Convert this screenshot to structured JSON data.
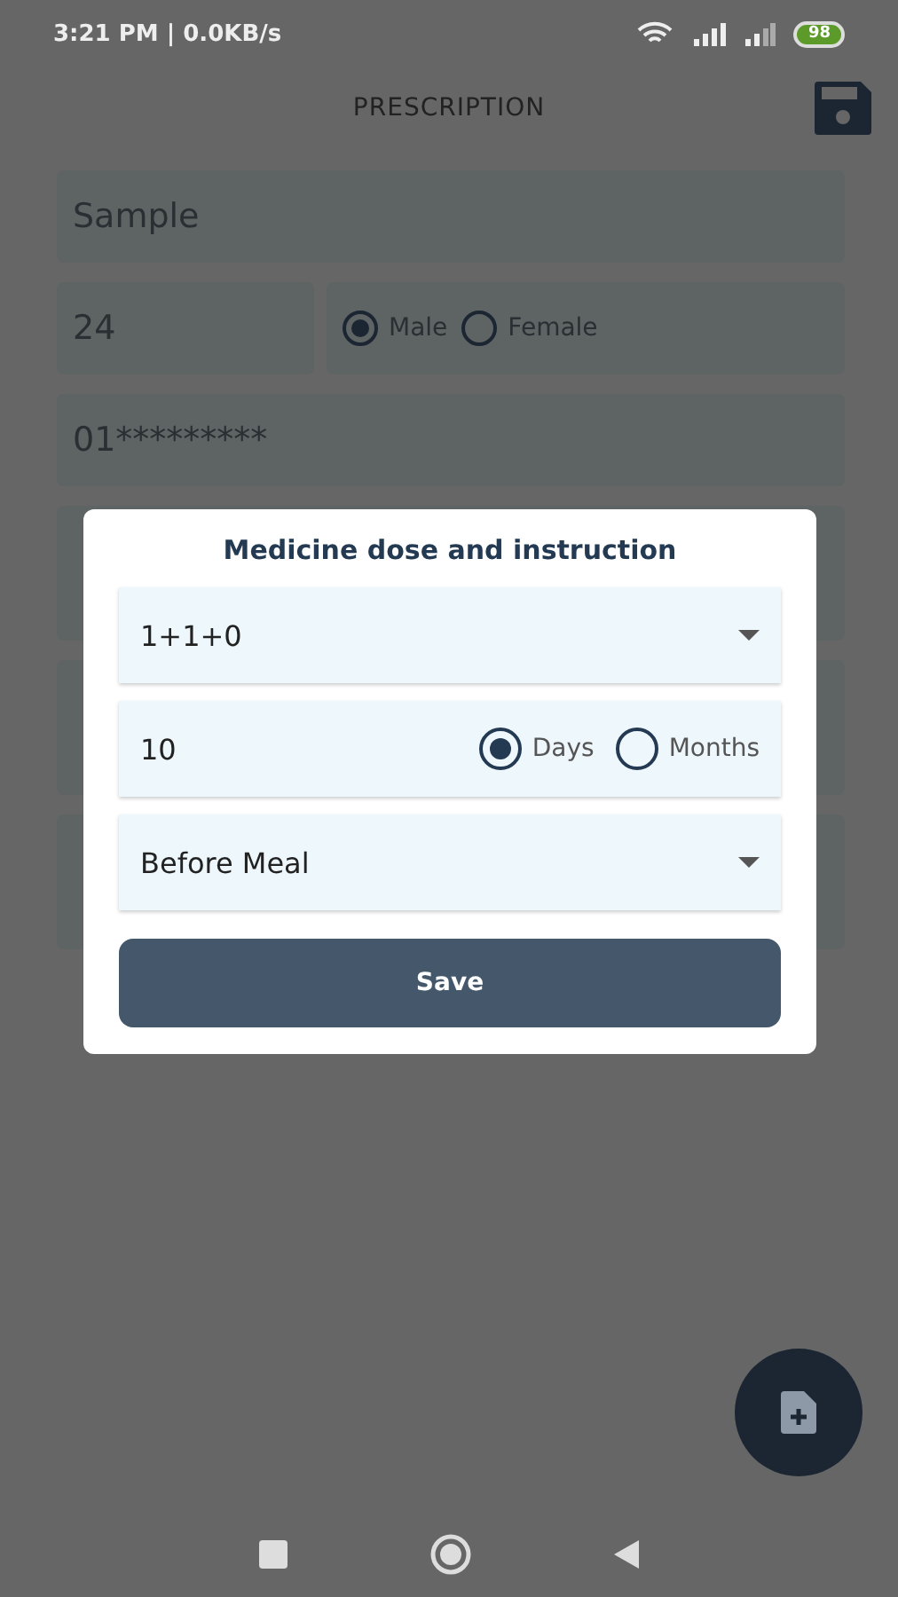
{
  "status_bar": {
    "time": "3:21 PM | 0.0KB/s",
    "battery": "98"
  },
  "header": {
    "title": "PRESCRIPTION"
  },
  "form": {
    "name": "Sample",
    "age": "24",
    "gender": [
      {
        "label": "Male",
        "selected": true
      },
      {
        "label": "Female",
        "selected": false
      }
    ],
    "phone": "01*********"
  },
  "dialog": {
    "title": "Medicine dose and instruction",
    "dose": "1+1+0",
    "duration": "10",
    "units": [
      {
        "label": "Days",
        "selected": true
      },
      {
        "label": "Months",
        "selected": false
      }
    ],
    "instruction": "Before Meal",
    "button": "Save"
  }
}
